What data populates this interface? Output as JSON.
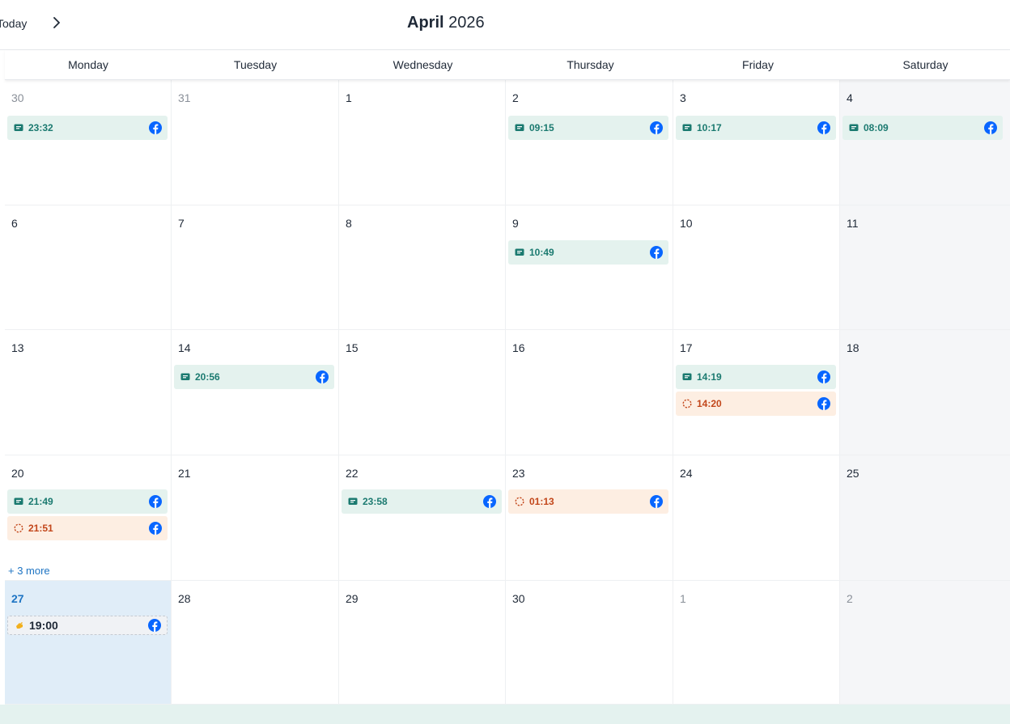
{
  "toolbar": {
    "today_label": "Today",
    "month": "April",
    "year": "2026"
  },
  "weekdays": [
    "Monday",
    "Tuesday",
    "Wednesday",
    "Thursday",
    "Friday",
    "Saturday"
  ],
  "weeks": [
    [
      "30",
      "31",
      "1",
      "2",
      "3",
      "4"
    ],
    [
      "6",
      "7",
      "8",
      "9",
      "10",
      "11"
    ],
    [
      "13",
      "14",
      "15",
      "16",
      "17",
      "18"
    ],
    [
      "20",
      "21",
      "22",
      "23",
      "24",
      "25"
    ],
    [
      "27",
      "28",
      "29",
      "30",
      "1",
      "2"
    ]
  ],
  "events": {
    "w0_mon": "23:32",
    "w0_thu": "09:15",
    "w0_fri": "10:17",
    "w0_sat": "08:09",
    "w1_thu": "10:49",
    "w2_tue": "20:56",
    "w2_fri_a": "14:19",
    "w2_fri_b": "14:20",
    "w3_mon_a": "21:49",
    "w3_mon_b": "21:51",
    "w3_wed": "23:58",
    "w3_thu": "01:13",
    "w4_mon": "19:00"
  },
  "more_label": "+ 3 more",
  "colors": {
    "post_bg": "#e4f2ee",
    "post_text": "#1b7a70",
    "pending_bg": "#fdeee2",
    "pending_text": "#c2461a",
    "facebook": "#0866ff",
    "today_bg": "#e0edf8",
    "link": "#1e74c3"
  },
  "icons": {
    "post": "message-icon",
    "pending": "pending-spinner-icon",
    "planned": "hand-pointing-icon",
    "network": "facebook-icon",
    "nav_next": "chevron-right-icon"
  }
}
